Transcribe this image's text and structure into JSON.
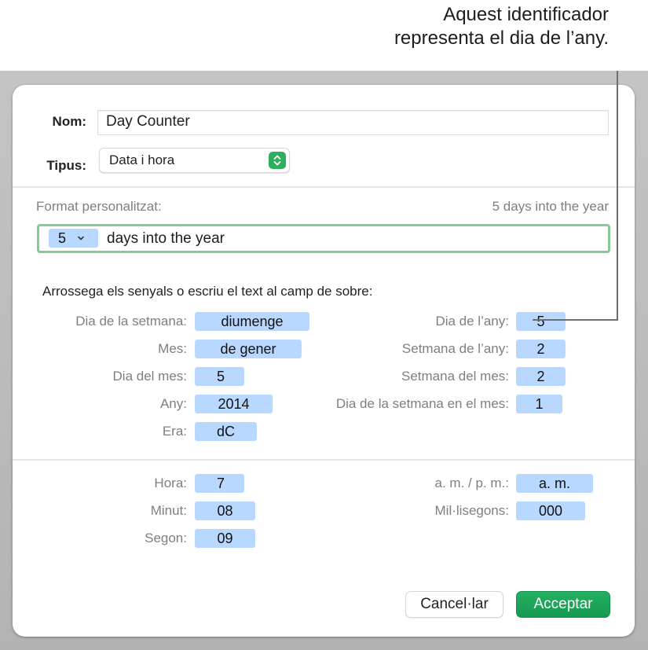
{
  "callout": {
    "line1": "Aquest identificador",
    "line2": "representa el dia de l’any."
  },
  "dialog": {
    "name_label": "Nom:",
    "name_value": "Day Counter",
    "type_label": "Tipus:",
    "type_value": "Data i hora",
    "custom_format_label": "Format personalitzat:",
    "preview": "5 days into the year",
    "format_field": {
      "token_value": "5",
      "text": "days into the year"
    },
    "instructions": "Arrossega els senyals o escriu el text al camp de sobre:",
    "date_tokens_left": [
      {
        "label": "Dia de la setmana:",
        "value": "diumenge"
      },
      {
        "label": "Mes:",
        "value": "de gener"
      },
      {
        "label": "Dia del mes:",
        "value": "5"
      },
      {
        "label": "Any:",
        "value": "2014"
      },
      {
        "label": "Era:",
        "value": "dC"
      }
    ],
    "date_tokens_right": [
      {
        "label": "Dia de l’any:",
        "value": "5"
      },
      {
        "label": "Setmana de l’any:",
        "value": "2"
      },
      {
        "label": "Setmana del mes:",
        "value": "2"
      },
      {
        "label": "Dia de la setmana en el mes:",
        "value": "1"
      }
    ],
    "time_tokens_left": [
      {
        "label": "Hora:",
        "value": "7"
      },
      {
        "label": "Minut:",
        "value": "08"
      },
      {
        "label": "Segon:",
        "value": "09"
      }
    ],
    "time_tokens_right": [
      {
        "label": "a. m. / p. m.:",
        "value": "a. m."
      },
      {
        "label": "Mil·lisegons:",
        "value": "000"
      }
    ],
    "cancel_label": "Cancel·lar",
    "accept_label": "Acceptar"
  },
  "colors": {
    "accent_green": "#1ea85a",
    "token_blue": "#b9d8ff",
    "focus_ring": "#86c99a"
  }
}
